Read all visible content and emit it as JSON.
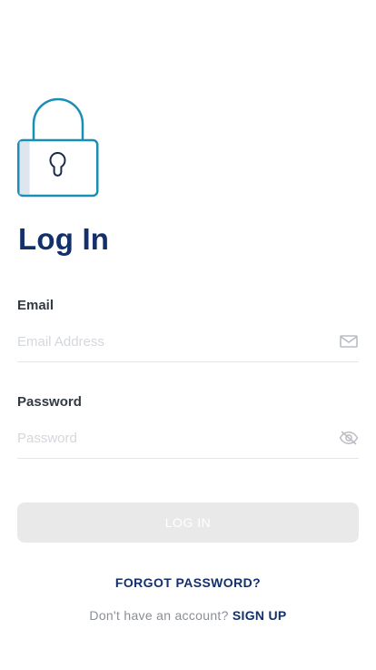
{
  "header": {
    "title": "Log In"
  },
  "form": {
    "email": {
      "label": "Email",
      "placeholder": "Email Address",
      "value": "",
      "icon": "mail-icon"
    },
    "password": {
      "label": "Password",
      "placeholder": "Password",
      "value": "",
      "icon": "eye-off-icon"
    },
    "submit_label": "LOG IN"
  },
  "links": {
    "forgot_password": "FORGOT PASSWORD?",
    "signup_prompt": "Don't have an account?",
    "signup_label": "SIGN UP"
  },
  "colors": {
    "brand": "#13306b",
    "accent": "#1a8fb5",
    "button_disabled": "#e9e9ea",
    "divider": "#e3e6ea"
  },
  "icons": {
    "hero": "lock-icon"
  }
}
